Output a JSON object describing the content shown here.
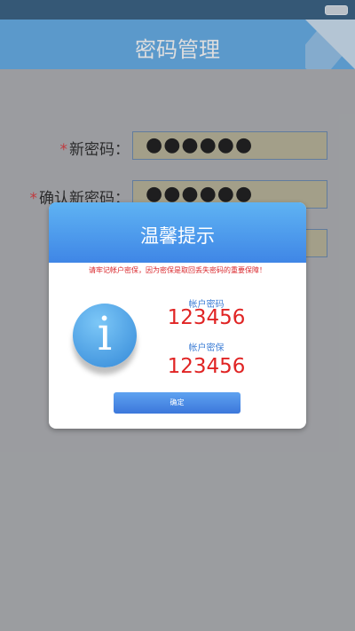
{
  "header": {
    "title": "密码管理"
  },
  "form": {
    "rows": [
      {
        "label": "新密码：",
        "value": "●●●●●●"
      },
      {
        "label": "确认新密码：",
        "value": "●●●●●●"
      },
      {
        "label": "",
        "value": ""
      }
    ],
    "required_mark": "*"
  },
  "dialog": {
    "title": "温馨提示",
    "warning": "请牢记帐户密保，因为密保是取回丢失密码的重要保障！",
    "info_glyph": "i",
    "account_password_label": "帐户密码",
    "account_password_value": "123456",
    "security_label": "帐户密保",
    "security_value": "123456",
    "confirm_label": "确定"
  },
  "colors": {
    "header": "#52a5e6",
    "dialog_header": "#3f86e6",
    "warning": "#d9252a",
    "accent": "#3f7fd6"
  }
}
